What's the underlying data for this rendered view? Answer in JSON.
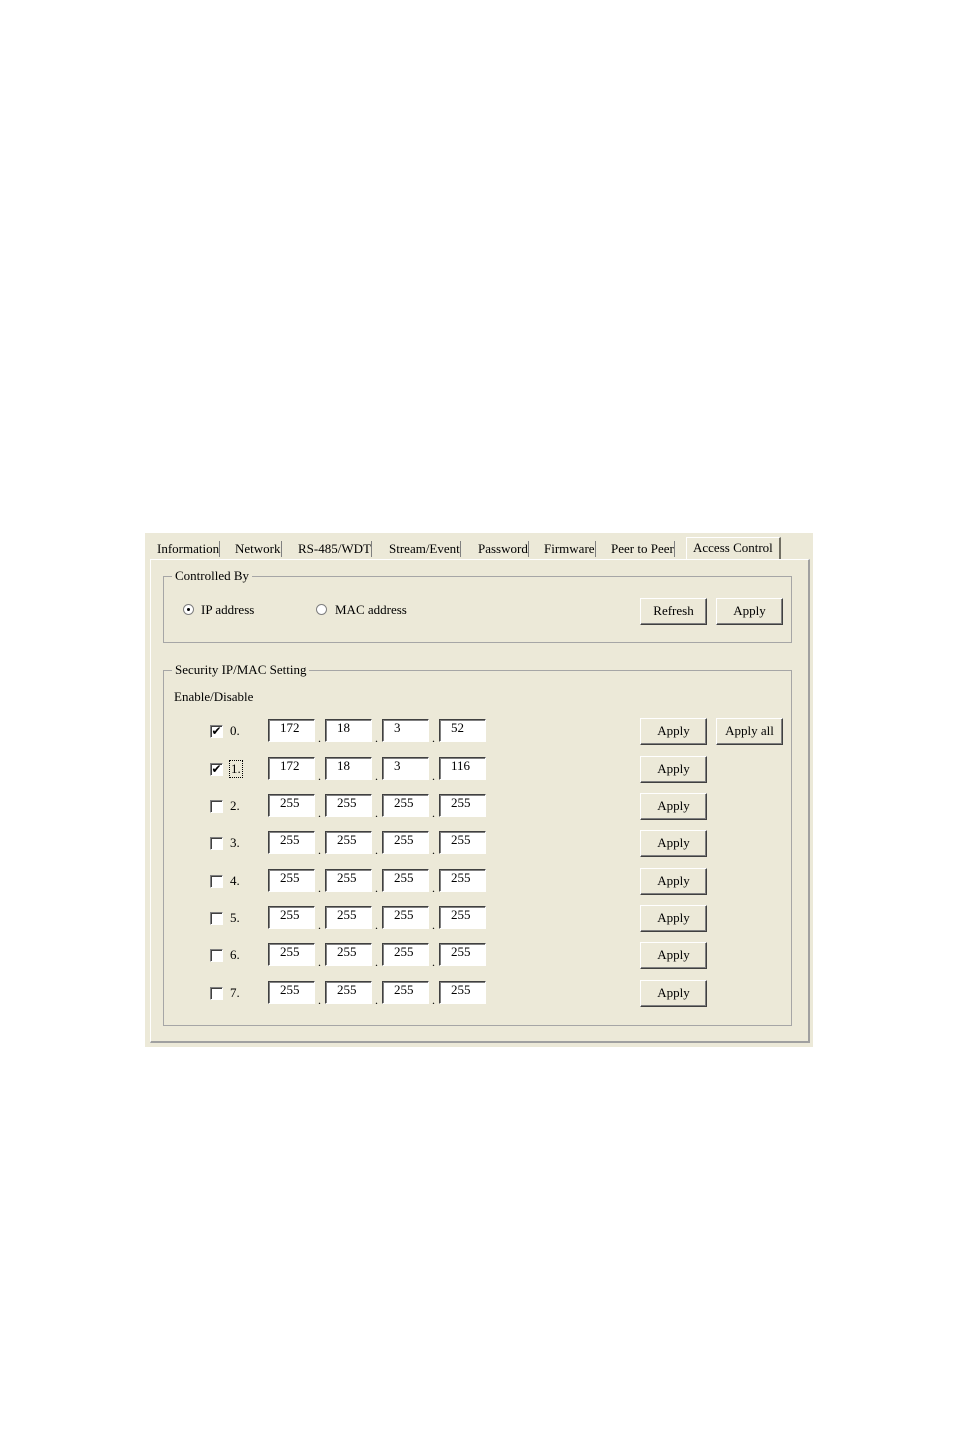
{
  "tabs": [
    "Information",
    "Network",
    "RS-485/WDT",
    "Stream/Event",
    "Password",
    "Firmware",
    "Peer to Peer",
    "Access Control"
  ],
  "active_tab": "Access Control",
  "controlled_by": {
    "group_label": "Controlled By",
    "options": [
      {
        "label": "IP address",
        "selected": true
      },
      {
        "label": "MAC address",
        "selected": false
      }
    ],
    "refresh_label": "Refresh",
    "apply_label": "Apply"
  },
  "security": {
    "group_label": "Security IP/MAC Setting",
    "enable_label": "Enable/Disable",
    "apply_label": "Apply",
    "apply_all_label": "Apply all",
    "rows": [
      {
        "label": "0.",
        "checked": true,
        "octets": [
          "172",
          "18",
          "3",
          "52"
        ]
      },
      {
        "label": "1.",
        "checked": true,
        "octets": [
          "172",
          "18",
          "3",
          "116"
        ]
      },
      {
        "label": "2.",
        "checked": false,
        "octets": [
          "255",
          "255",
          "255",
          "255"
        ]
      },
      {
        "label": "3.",
        "checked": false,
        "octets": [
          "255",
          "255",
          "255",
          "255"
        ]
      },
      {
        "label": "4.",
        "checked": false,
        "octets": [
          "255",
          "255",
          "255",
          "255"
        ]
      },
      {
        "label": "5.",
        "checked": false,
        "octets": [
          "255",
          "255",
          "255",
          "255"
        ]
      },
      {
        "label": "6.",
        "checked": false,
        "octets": [
          "255",
          "255",
          "255",
          "255"
        ]
      },
      {
        "label": "7.",
        "checked": false,
        "octets": [
          "255",
          "255",
          "255",
          "255"
        ]
      }
    ]
  }
}
